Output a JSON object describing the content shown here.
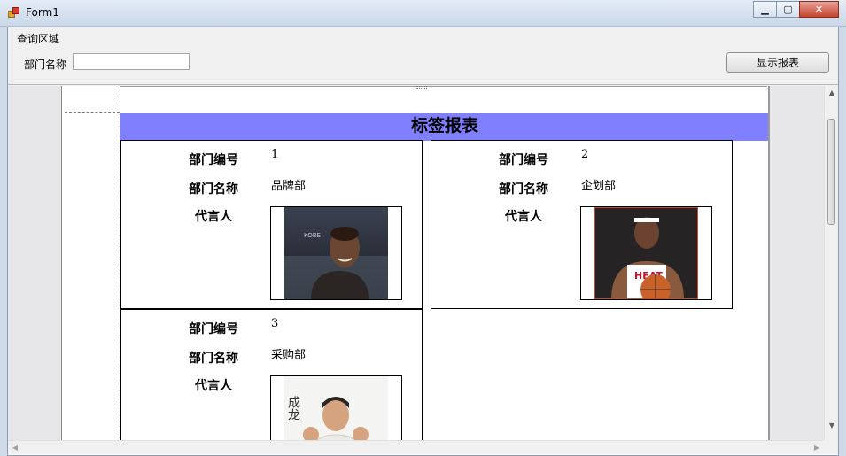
{
  "window": {
    "title": "Form1",
    "minimize_glyph": "▁",
    "maximize_glyph": "▢",
    "close_glyph": "✕"
  },
  "query_area": {
    "group_label": "查询区域",
    "dept_name_label": "部门名称",
    "dept_name_value": "",
    "show_button_label": "显示报表"
  },
  "report": {
    "title": "标签报表",
    "title_bg": "#8080ff",
    "labels": {
      "dept_no": "部门编号",
      "dept_name": "部门名称",
      "spokesperson": "代言人"
    },
    "cards": [
      {
        "dept_no": "1",
        "dept_name": "品牌部",
        "photo": "kobe-photo"
      },
      {
        "dept_no": "2",
        "dept_name": "企划部",
        "photo": "lebron-photo"
      },
      {
        "dept_no": "3",
        "dept_name": "采购部",
        "photo": "jackie-chan-photo",
        "photo_text": "成龙"
      }
    ]
  },
  "icons": {
    "app": "form-app-icon",
    "scroll_up": "▲",
    "scroll_down": "▼",
    "scroll_left": "◀",
    "scroll_right": "▶"
  }
}
